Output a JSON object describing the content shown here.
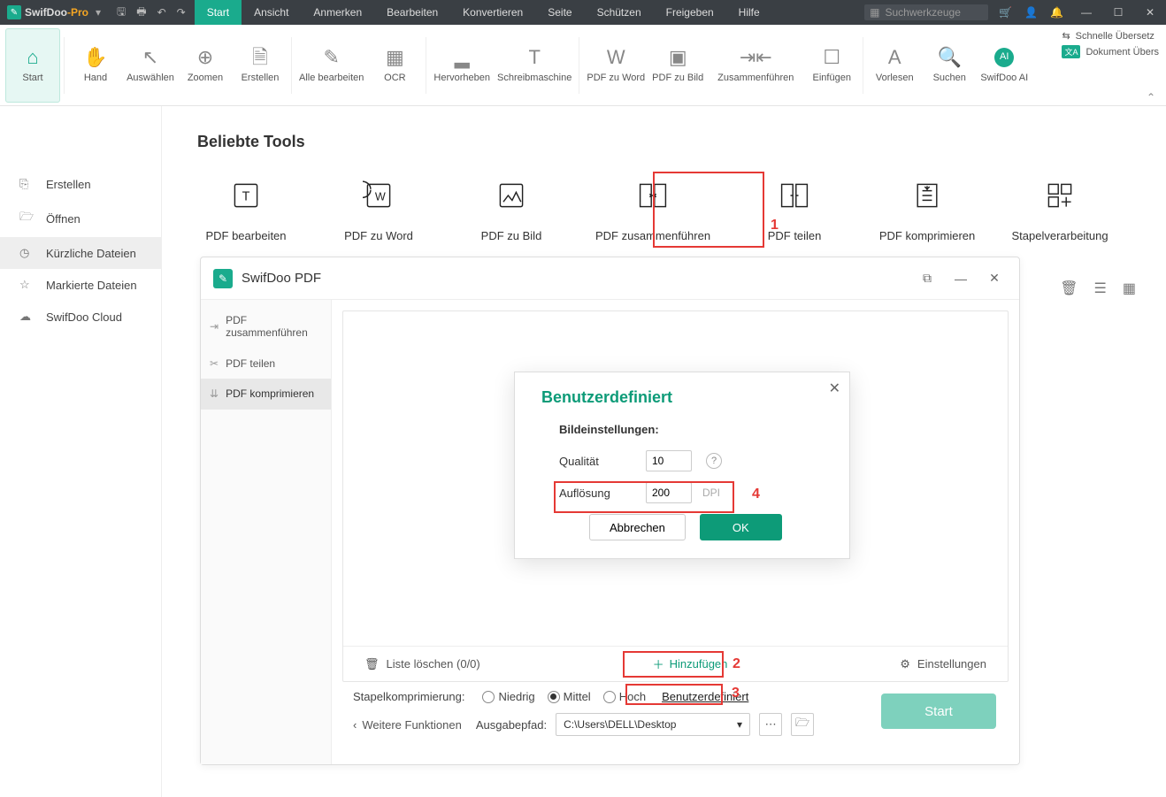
{
  "titlebar": {
    "brand": "SwifDoo",
    "brand_suffix": "-Pro",
    "search_placeholder": "Suchwerkzeuge"
  },
  "menu": [
    "Start",
    "Ansicht",
    "Anmerken",
    "Bearbeiten",
    "Konvertieren",
    "Seite",
    "Schützen",
    "Freigeben",
    "Hilfe"
  ],
  "ribbon": {
    "items": [
      {
        "label": "Start",
        "icon": "⌂",
        "active": true
      },
      {
        "label": "Hand",
        "icon": "✋"
      },
      {
        "label": "Auswählen",
        "icon": "↖"
      },
      {
        "label": "Zoomen",
        "icon": "⊕"
      },
      {
        "label": "Erstellen",
        "icon": "🗎"
      },
      {
        "label": "Alle bearbeiten",
        "icon": "✎"
      },
      {
        "label": "OCR",
        "icon": "▦"
      },
      {
        "label": "Hervorheben",
        "icon": "▂"
      },
      {
        "label": "Schreibmaschine",
        "icon": "T"
      },
      {
        "label": "PDF zu Word",
        "icon": "W"
      },
      {
        "label": "PDF zu Bild",
        "icon": "▣"
      },
      {
        "label": "Zusammenführen",
        "icon": "⇥⇤"
      },
      {
        "label": "Einfügen",
        "icon": "☐"
      },
      {
        "label": "Vorlesen",
        "icon": "A"
      },
      {
        "label": "Suchen",
        "icon": "🔍"
      },
      {
        "label": "SwifDoo AI",
        "icon": "AI",
        "ai": true
      }
    ],
    "extra1": "Schnelle Übersetz",
    "extra2": "Dokument Übers"
  },
  "sidebar": [
    {
      "label": "Erstellen",
      "icon": "⎘"
    },
    {
      "label": "Öffnen",
      "icon": "🗁"
    },
    {
      "label": "Kürzliche Dateien",
      "icon": "◷",
      "active": true
    },
    {
      "label": "Markierte Dateien",
      "icon": "☆"
    },
    {
      "label": "SwifDoo Cloud",
      "icon": "☁"
    }
  ],
  "content": {
    "section_title": "Beliebte Tools",
    "tools": [
      "PDF bearbeiten",
      "PDF zu Word",
      "PDF zu Bild",
      "PDF zusammenführen",
      "PDF teilen",
      "PDF komprimieren",
      "Stapelverarbeitung"
    ]
  },
  "annotations": {
    "n1": "1",
    "n2": "2",
    "n3": "3",
    "n4": "4"
  },
  "modal": {
    "title": "SwifDoo PDF",
    "sidebar": [
      {
        "label": "PDF zusammenführen"
      },
      {
        "label": "PDF teilen"
      },
      {
        "label": "PDF komprimieren",
        "active": true
      }
    ],
    "footer": {
      "clear_list": "Liste löschen (0/0)",
      "add": "Hinzufügen",
      "settings": "Einstellungen"
    },
    "bottom": {
      "back": "Weitere Funktionen",
      "comp_label": "Stapelkomprimierung:",
      "low": "Niedrig",
      "med": "Mittel",
      "high": "Hoch",
      "custom": "Benutzerdefiniert",
      "out_label": "Ausgabepfad:",
      "out_path": "C:\\Users\\DELL\\Desktop",
      "start": "Start"
    },
    "custom_dialog": {
      "title": "Benutzerdefiniert",
      "subtitle": "Bildeinstellungen:",
      "quality_label": "Qualität",
      "quality_value": "10",
      "resolution_label": "Auflösung",
      "resolution_value": "200",
      "dpi": "DPI",
      "cancel": "Abbrechen",
      "ok": "OK"
    }
  }
}
